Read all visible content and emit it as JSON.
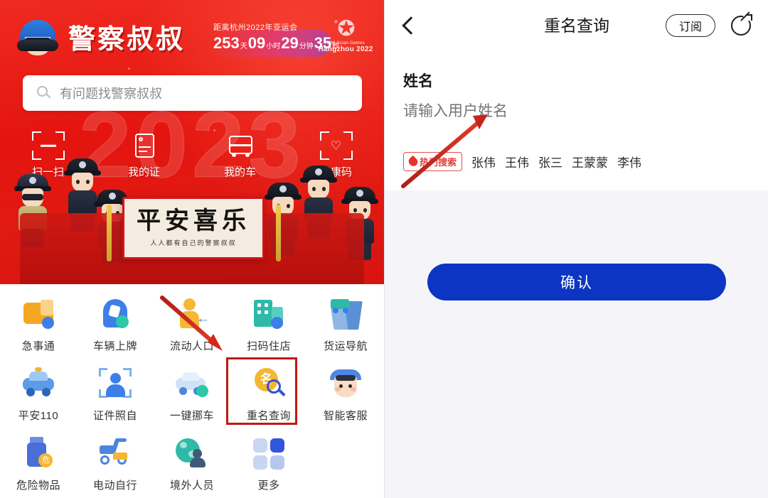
{
  "left_panel": {
    "brand": {
      "name": "警察叔叔",
      "icon": "police-cap-icon"
    },
    "countdown": {
      "label": "距离杭州2022年亚运会",
      "days": "253",
      "days_unit": "天",
      "hours": "09",
      "hours_unit": "小时",
      "minutes": "29",
      "minutes_unit": "分钟",
      "seconds": "35",
      "seconds_unit": "秒"
    },
    "asian_games": {
      "line1": "19th Asian Games",
      "line2": "Hangzhou 2022"
    },
    "search": {
      "placeholder": "有问题找警察叔叔",
      "icon": "search-icon"
    },
    "quick_actions": [
      {
        "label": "扫一扫",
        "icon": "scan-frame-icon"
      },
      {
        "label": "我的证",
        "icon": "id-card-icon"
      },
      {
        "label": "我的车",
        "icon": "car-front-icon"
      },
      {
        "label": "健康码",
        "icon": "heart-scan-icon"
      }
    ],
    "banner": {
      "title": "平安喜乐",
      "subtitle": "人人都有自己的警察叔叔"
    },
    "watermark": "2023",
    "apps": [
      {
        "label": "急事通",
        "icon": "urgent-service-icon",
        "highlighted": false
      },
      {
        "label": "车辆上牌",
        "icon": "vehicle-plate-icon",
        "highlighted": false
      },
      {
        "label": "流动人口",
        "icon": "floating-population-icon",
        "highlighted": false
      },
      {
        "label": "扫码住店",
        "icon": "hotel-scan-icon",
        "highlighted": false
      },
      {
        "label": "货运导航",
        "icon": "freight-nav-icon",
        "highlighted": false
      },
      {
        "label": "平安110",
        "icon": "police-car-icon",
        "highlighted": false
      },
      {
        "label": "证件照自",
        "icon": "id-photo-icon",
        "highlighted": false
      },
      {
        "label": "一键挪车",
        "icon": "move-car-icon",
        "highlighted": false
      },
      {
        "label": "重名查询",
        "icon": "name-search-icon",
        "highlighted": true
      },
      {
        "label": "智能客服",
        "icon": "smart-service-icon",
        "highlighted": false
      },
      {
        "label": "危险物品",
        "icon": "hazard-bottle-icon",
        "highlighted": false
      },
      {
        "label": "电动自行",
        "icon": "e-bike-icon",
        "highlighted": false
      },
      {
        "label": "境外人员",
        "icon": "foreigner-globe-icon",
        "highlighted": false
      },
      {
        "label": "更多",
        "icon": "more-grid-icon",
        "highlighted": false
      }
    ]
  },
  "right_panel": {
    "header": {
      "title": "重名查询",
      "back_icon": "back-chevron-icon",
      "subscribe_label": "订阅",
      "share_icon": "share-icon"
    },
    "form": {
      "name_label": "姓名",
      "name_value": "",
      "name_placeholder": "请输入用户姓名",
      "hot_badge": "热门搜索",
      "hot_badge_icon": "flame-icon",
      "hot_names": [
        "张伟",
        "王伟",
        "张三",
        "王蒙蒙",
        "李伟"
      ],
      "confirm_label": "确认"
    }
  },
  "colors": {
    "hero_red": "#e4140f",
    "confirm_blue": "#0d35c4",
    "annotation_red": "#c0190f",
    "panel_bg": "#f4f4f9",
    "hot_red": "#e0413a"
  }
}
